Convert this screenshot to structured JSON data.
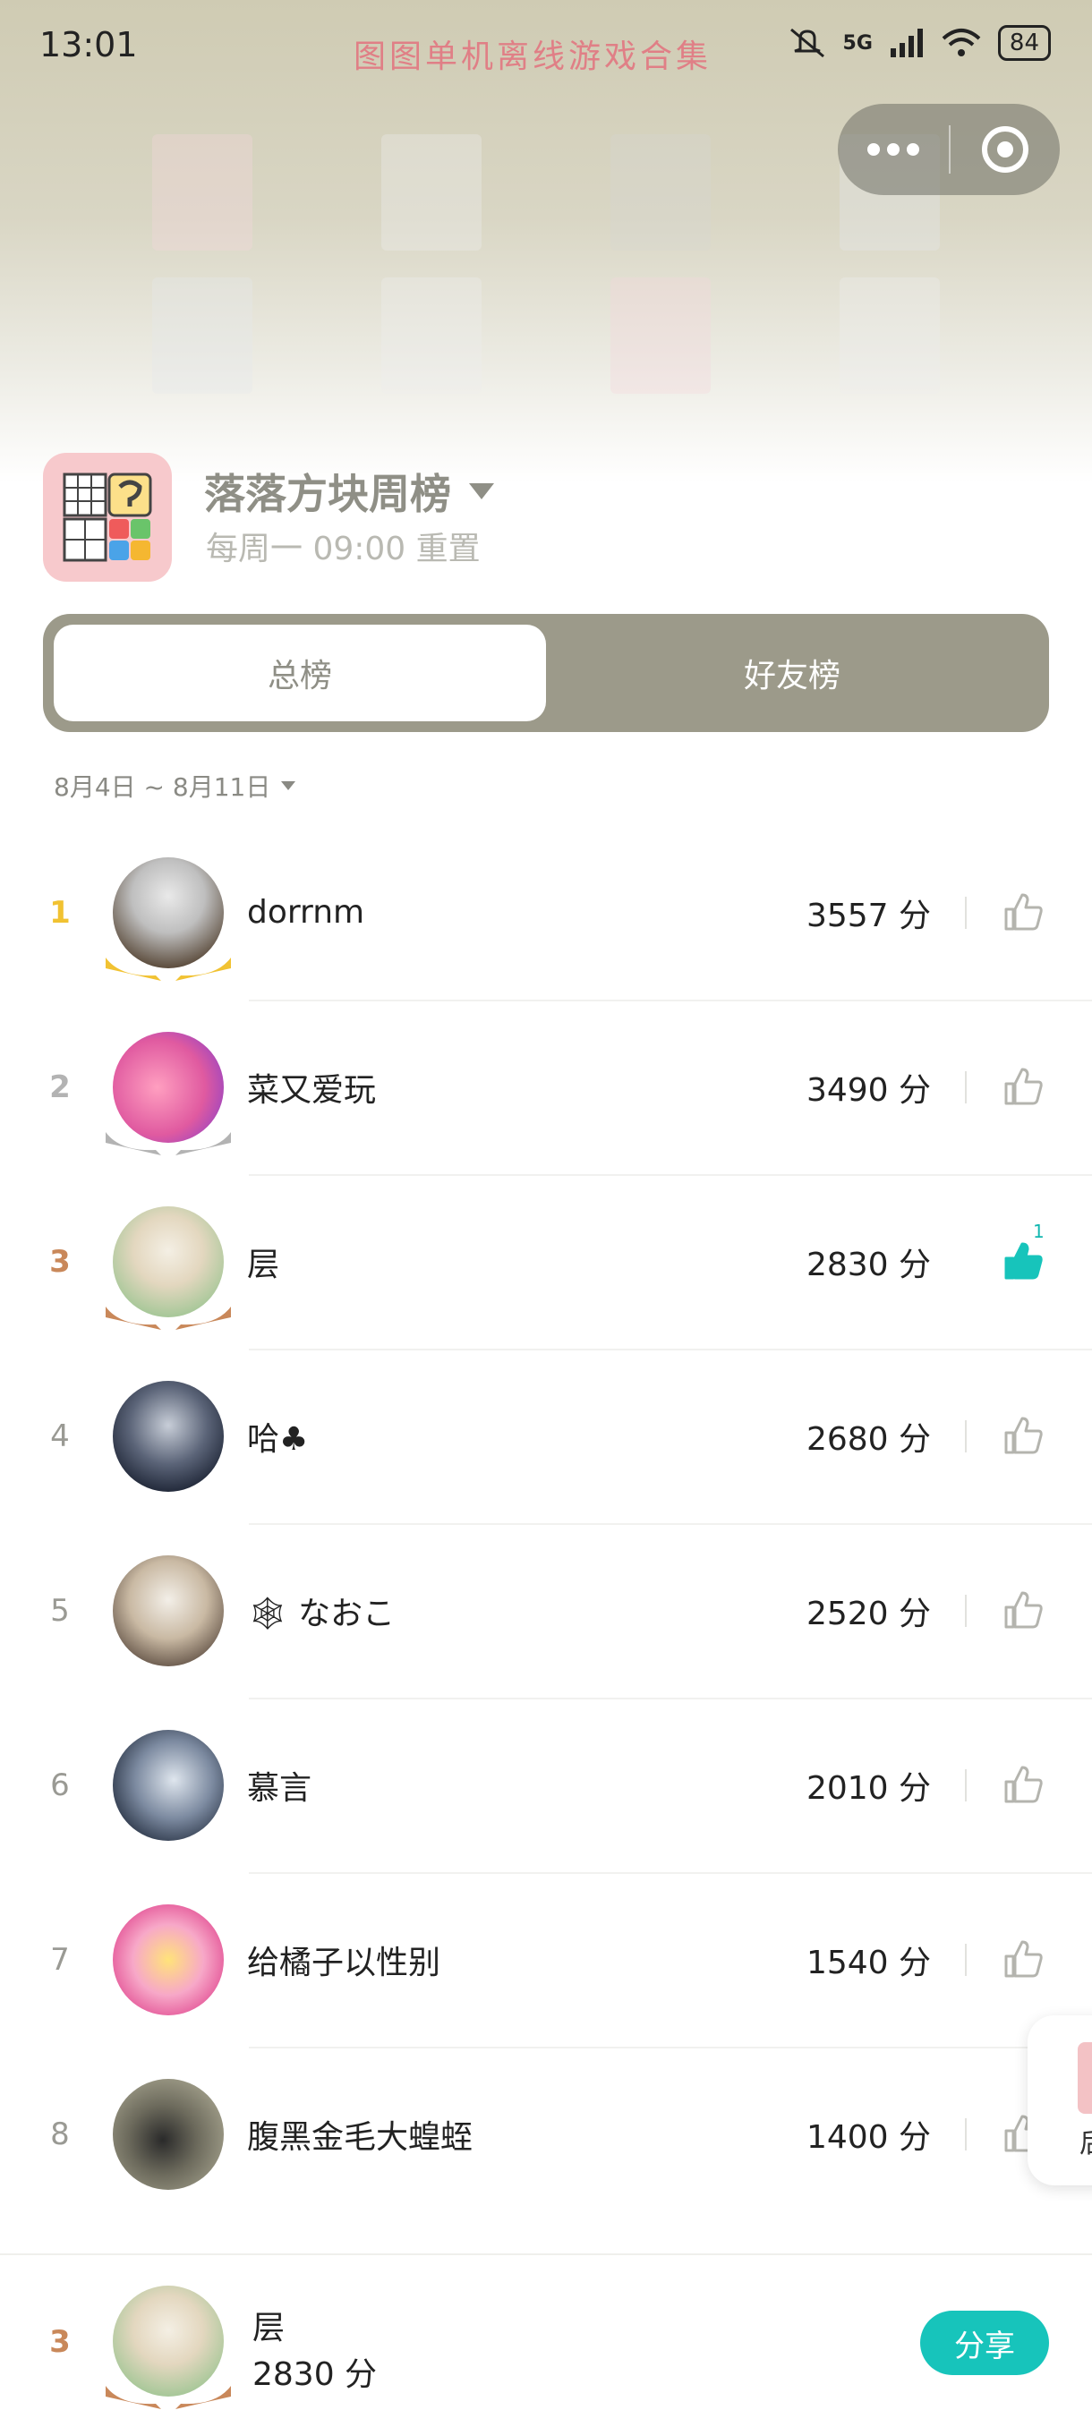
{
  "status_bar": {
    "time": "13:01",
    "watermark": "图图单机离线游戏合集",
    "network": "5G",
    "battery": "84"
  },
  "game": {
    "title": "落落方块周榜",
    "subtitle": "每周一 09:00 重置"
  },
  "tabs": [
    {
      "label": "总榜",
      "active": true
    },
    {
      "label": "好友榜",
      "active": false
    }
  ],
  "date_range": "8月4日 ~ 8月11日",
  "leaderboard": [
    {
      "rank": "1",
      "name": "dorrnm",
      "score": "3557 分",
      "liked": false,
      "like_count": ""
    },
    {
      "rank": "2",
      "name": "菜又爱玩",
      "score": "3490 分",
      "liked": false,
      "like_count": ""
    },
    {
      "rank": "3",
      "name": "层",
      "score": "2830 分",
      "liked": true,
      "like_count": "1"
    },
    {
      "rank": "4",
      "name": "哈♣",
      "score": "2680 分",
      "liked": false,
      "like_count": ""
    },
    {
      "rank": "5",
      "name": "🕸 なおこ",
      "score": "2520 分",
      "liked": false,
      "like_count": ""
    },
    {
      "rank": "6",
      "name": "慕言",
      "score": "2010 分",
      "liked": false,
      "like_count": ""
    },
    {
      "rank": "7",
      "name": "给橘子以性别",
      "score": "1540 分",
      "liked": false,
      "like_count": ""
    },
    {
      "rank": "8",
      "name": "腹黑金毛大蝗蛭",
      "score": "1400 分",
      "liked": false,
      "like_count": ""
    }
  ],
  "me": {
    "rank": "3",
    "name": "层",
    "score": "2830 分"
  },
  "share_label": "分享",
  "side_card_text": "后",
  "colors": {
    "accent": "#17c4bb",
    "tab_bg": "#9c9a8a",
    "gold": "#f1c232",
    "silver": "#b3b3b3",
    "bronze": "#c9885a"
  }
}
